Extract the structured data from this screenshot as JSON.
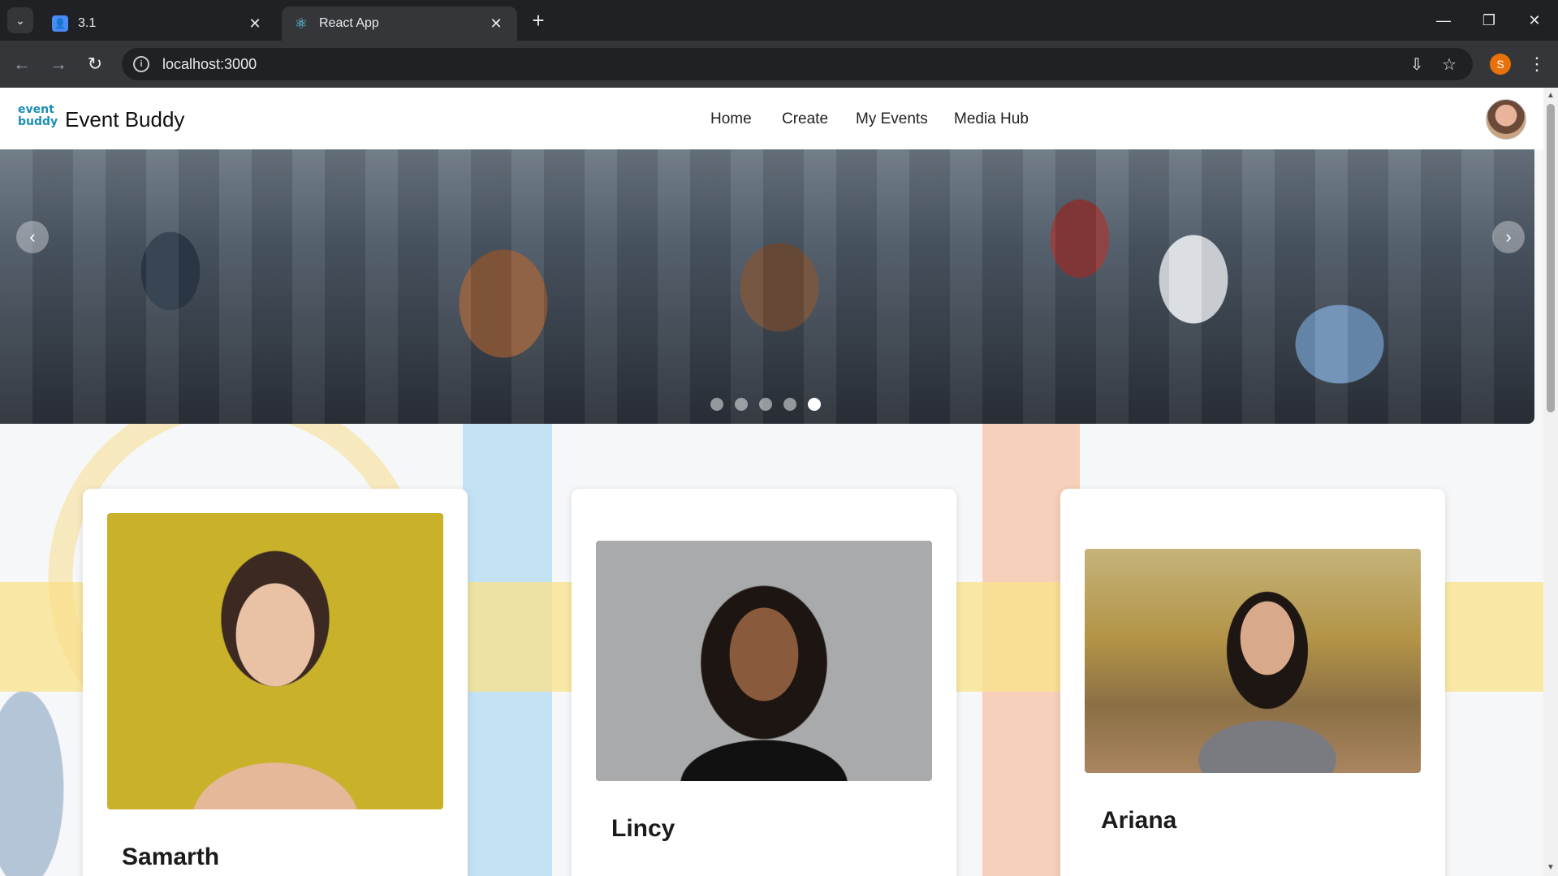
{
  "browser": {
    "tabs": [
      {
        "title": "3.1",
        "active": false
      },
      {
        "title": "React App",
        "active": true
      }
    ],
    "url": "localhost:3000",
    "profile_initial": "S"
  },
  "app": {
    "brand": "Event Buddy",
    "logo_text_top": "event",
    "logo_text_bottom": "buddy",
    "nav": [
      "Home",
      "Create",
      "My Events",
      "Media Hub"
    ]
  },
  "carousel": {
    "slide_count": 5,
    "active_index": 4
  },
  "cards": [
    {
      "name": "Samarth"
    },
    {
      "name": "Lincy"
    },
    {
      "name": "Ariana"
    }
  ],
  "icons": {
    "prev": "‹",
    "next": "›"
  }
}
